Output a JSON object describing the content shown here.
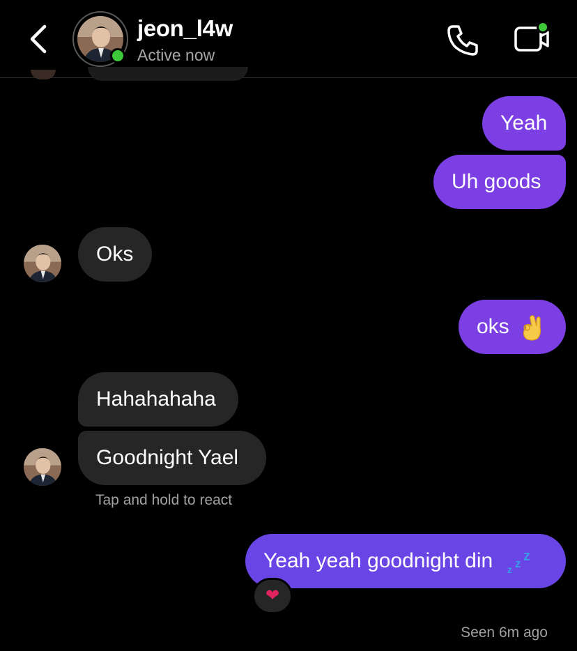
{
  "header": {
    "username": "jeon_l4w",
    "status": "Active now"
  },
  "messages": [
    {
      "direction": "out",
      "text": "Yeah"
    },
    {
      "direction": "out",
      "text": "Uh goods"
    },
    {
      "direction": "in",
      "text": "Oks"
    },
    {
      "direction": "out",
      "text": "oks"
    },
    {
      "direction": "in",
      "text": "Hahahahaha"
    },
    {
      "direction": "in",
      "text": "Goodnight Yael"
    },
    {
      "direction": "out",
      "text": "Yeah yeah goodnight din"
    }
  ],
  "react_hint": "Tap and hold to react",
  "reaction": "❤",
  "seen": "Seen 6m ago",
  "colors": {
    "outgoing_bubble": "#7b3fe4",
    "incoming_bubble": "#262626",
    "online": "#3ec93a"
  },
  "icons": [
    "back-chevron",
    "phone",
    "video-camera"
  ]
}
